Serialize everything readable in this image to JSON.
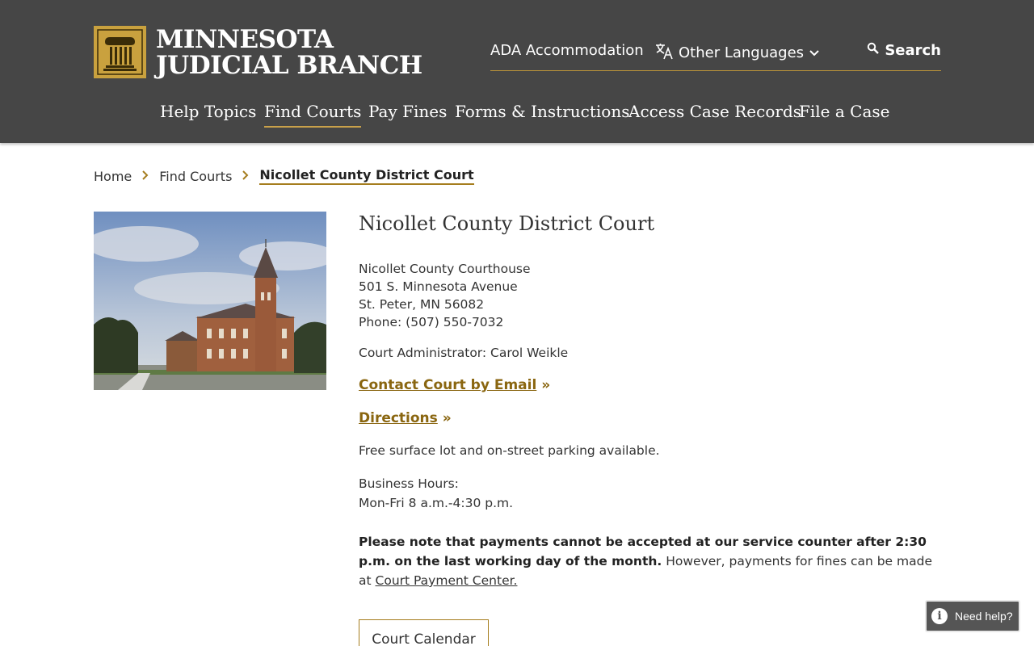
{
  "header": {
    "logo_line1": "MINNESOTA",
    "logo_line2": "JUDICIAL BRANCH",
    "utility": {
      "ada": "ADA Accommodation",
      "languages": "Other Languages",
      "search": "Search"
    },
    "nav": [
      {
        "label": "Help Topics",
        "active": false
      },
      {
        "label": "Find Courts",
        "active": true
      },
      {
        "label": "Pay Fines",
        "active": false
      },
      {
        "label": "Forms & Instructions",
        "active": false
      },
      {
        "label": "Access Case Records",
        "active": false
      },
      {
        "label": "File a Case",
        "active": false
      }
    ]
  },
  "breadcrumb": {
    "home": "Home",
    "parent": "Find Courts",
    "current": "Nicollet County District Court"
  },
  "court": {
    "title": "Nicollet County District Court",
    "address_lines": [
      "Nicollet County Courthouse",
      "501 S. Minnesota Avenue",
      "St. Peter, MN 56082",
      "Phone: (507) 550-7032"
    ],
    "administrator": "Court Administrator: Carol Weikle",
    "email_link": "Contact Court by Email",
    "directions_link": "Directions",
    "link_suffix": "»",
    "parking": "Free surface lot and on-street parking available.",
    "hours_label": "Business Hours:",
    "hours_value": "Mon-Fri 8 a.m.-4:30 p.m.",
    "notice_bold": "Please note that payments cannot be accepted at our service counter after 2:30 p.m. on the last working day of the month.",
    "notice_text": " However, payments for fines can be made at ",
    "notice_link": "Court Payment Center.",
    "calendar_button": "Court Calendar"
  },
  "help_widget": {
    "label": "Need help?",
    "icon_glyph": "i"
  },
  "colors": {
    "header_bg": "#464646",
    "accent_gold": "#a57d1e",
    "link_gold": "#8a6610"
  }
}
